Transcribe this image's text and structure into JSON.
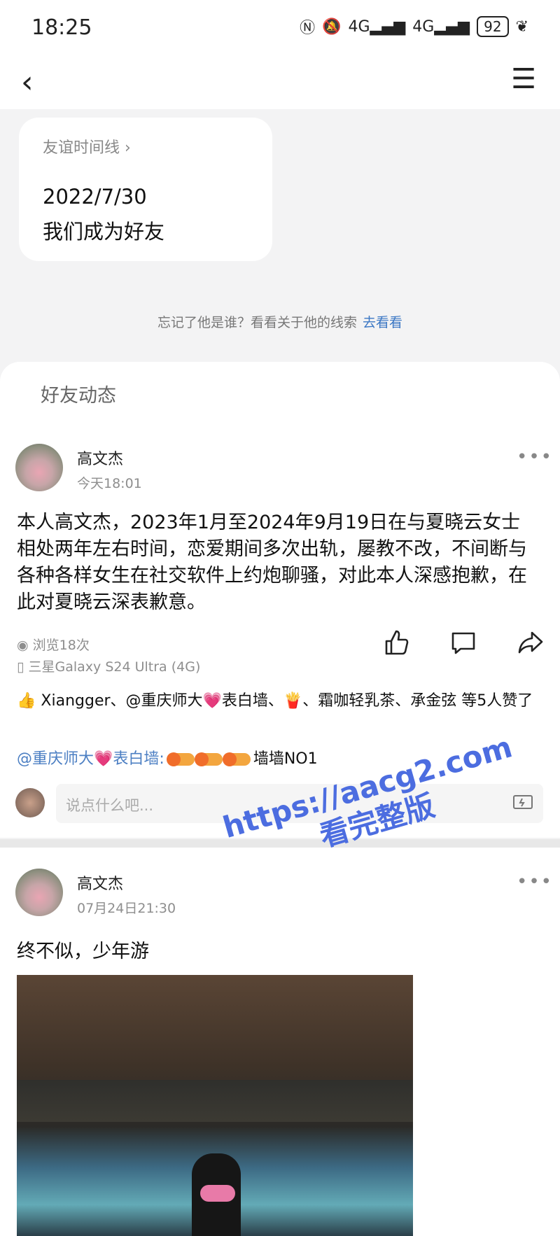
{
  "status_bar": {
    "time": "18:25",
    "signal_1": "4G",
    "signal_2": "4G",
    "battery": "92"
  },
  "friend_card": {
    "title": "友谊时间线",
    "date": "2022/7/30",
    "description": "我们成为好友"
  },
  "hint": {
    "text": "忘记了他是谁？看看关于他的线索",
    "link": "去看看"
  },
  "feed": {
    "title": "好友动态"
  },
  "post1": {
    "author": "高文杰",
    "time": "今天18:01",
    "content": "本人高文杰，2023年1月至2024年9月19日在与夏晓云女士相处两年左右时间，恋爱期间多次出轨，屡教不改，不间断与各种各样女生在社交软件上约炮聊骚，对此本人深感抱歉，在此对夏晓云深表歉意。",
    "views": "浏览18次",
    "device": "三星Galaxy S24 Ultra (4G)",
    "likes_text": "Xiangger、@重庆师大💗表白墙、🍟、霜咖轻乳茶、承金弦 等5人赞了",
    "comment_author": "@重庆师大💗表白墙:",
    "comment_text": "墙墙NO1",
    "comment_placeholder": "说点什么吧..."
  },
  "post2": {
    "author": "高文杰",
    "time": "07月24日21:30",
    "content": "终不似，少年游"
  },
  "watermark": {
    "line1": "https://aacg2.com",
    "line2": "看完整版"
  }
}
